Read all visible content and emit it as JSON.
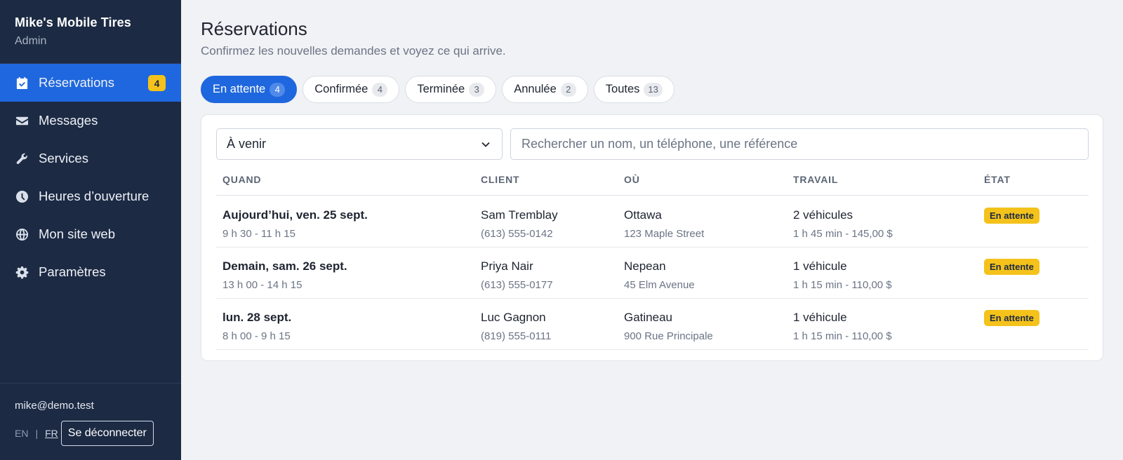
{
  "brand": {
    "name": "Mike's Mobile Tires",
    "role": "Admin"
  },
  "nav": [
    {
      "label": "Réservations",
      "icon": "calendar-check-icon",
      "badge": "4",
      "active": true
    },
    {
      "label": "Messages",
      "icon": "envelope-icon"
    },
    {
      "label": "Services",
      "icon": "wrench-icon"
    },
    {
      "label": "Heures d’ouverture",
      "icon": "clock-icon"
    },
    {
      "label": "Mon site web",
      "icon": "globe-icon"
    },
    {
      "label": "Paramètres",
      "icon": "gear-icon"
    }
  ],
  "footer": {
    "email": "mike@demo.test",
    "lang_en": "EN",
    "lang_sep": "|",
    "lang_fr": "FR",
    "logout": "Se déconnecter"
  },
  "page": {
    "title": "Réservations",
    "subtitle": "Confirmez les nouvelles demandes et voyez ce qui arrive."
  },
  "tabs": [
    {
      "label": "En attente",
      "count": "4",
      "active": true
    },
    {
      "label": "Confirmée",
      "count": "4"
    },
    {
      "label": "Terminée",
      "count": "3"
    },
    {
      "label": "Annulée",
      "count": "2"
    },
    {
      "label": "Toutes",
      "count": "13"
    }
  ],
  "filter": {
    "selected": "À venir",
    "search_placeholder": "Rechercher un nom, un téléphone, une référence"
  },
  "table": {
    "headers": {
      "when": "QUAND",
      "client": "CLIENT",
      "where": "OÙ",
      "job": "TRAVAIL",
      "state": "ÉTAT"
    },
    "rows": [
      {
        "date": "Aujourd’hui, ven. 25 sept.",
        "time": "9 h 30 - 11 h 15",
        "client": "Sam Tremblay",
        "phone": "(613) 555-0142",
        "city": "Ottawa",
        "address": "123 Maple Street",
        "vehicles": "2 véhicules",
        "duration": "1 h 45 min - 145,00 $",
        "status": "En attente"
      },
      {
        "date": "Demain, sam. 26 sept.",
        "time": "13 h 00 - 14 h 15",
        "client": "Priya Nair",
        "phone": "(613) 555-0177",
        "city": "Nepean",
        "address": "45 Elm Avenue",
        "vehicles": "1 véhicule",
        "duration": "1 h 15 min - 110,00 $",
        "status": "En attente"
      },
      {
        "date": "lun. 28 sept.",
        "time": "8 h 00 - 9 h 15",
        "client": "Luc Gagnon",
        "phone": "(819) 555-0111",
        "city": "Gatineau",
        "address": "900 Rue Principale",
        "vehicles": "1 véhicule",
        "duration": "1 h 15 min - 110,00 $",
        "status": "En attente"
      }
    ]
  },
  "colors": {
    "sidebar": "#1c2a44",
    "accent": "#1f67de",
    "badge": "#f4c21b",
    "background": "#f1f2f5"
  }
}
